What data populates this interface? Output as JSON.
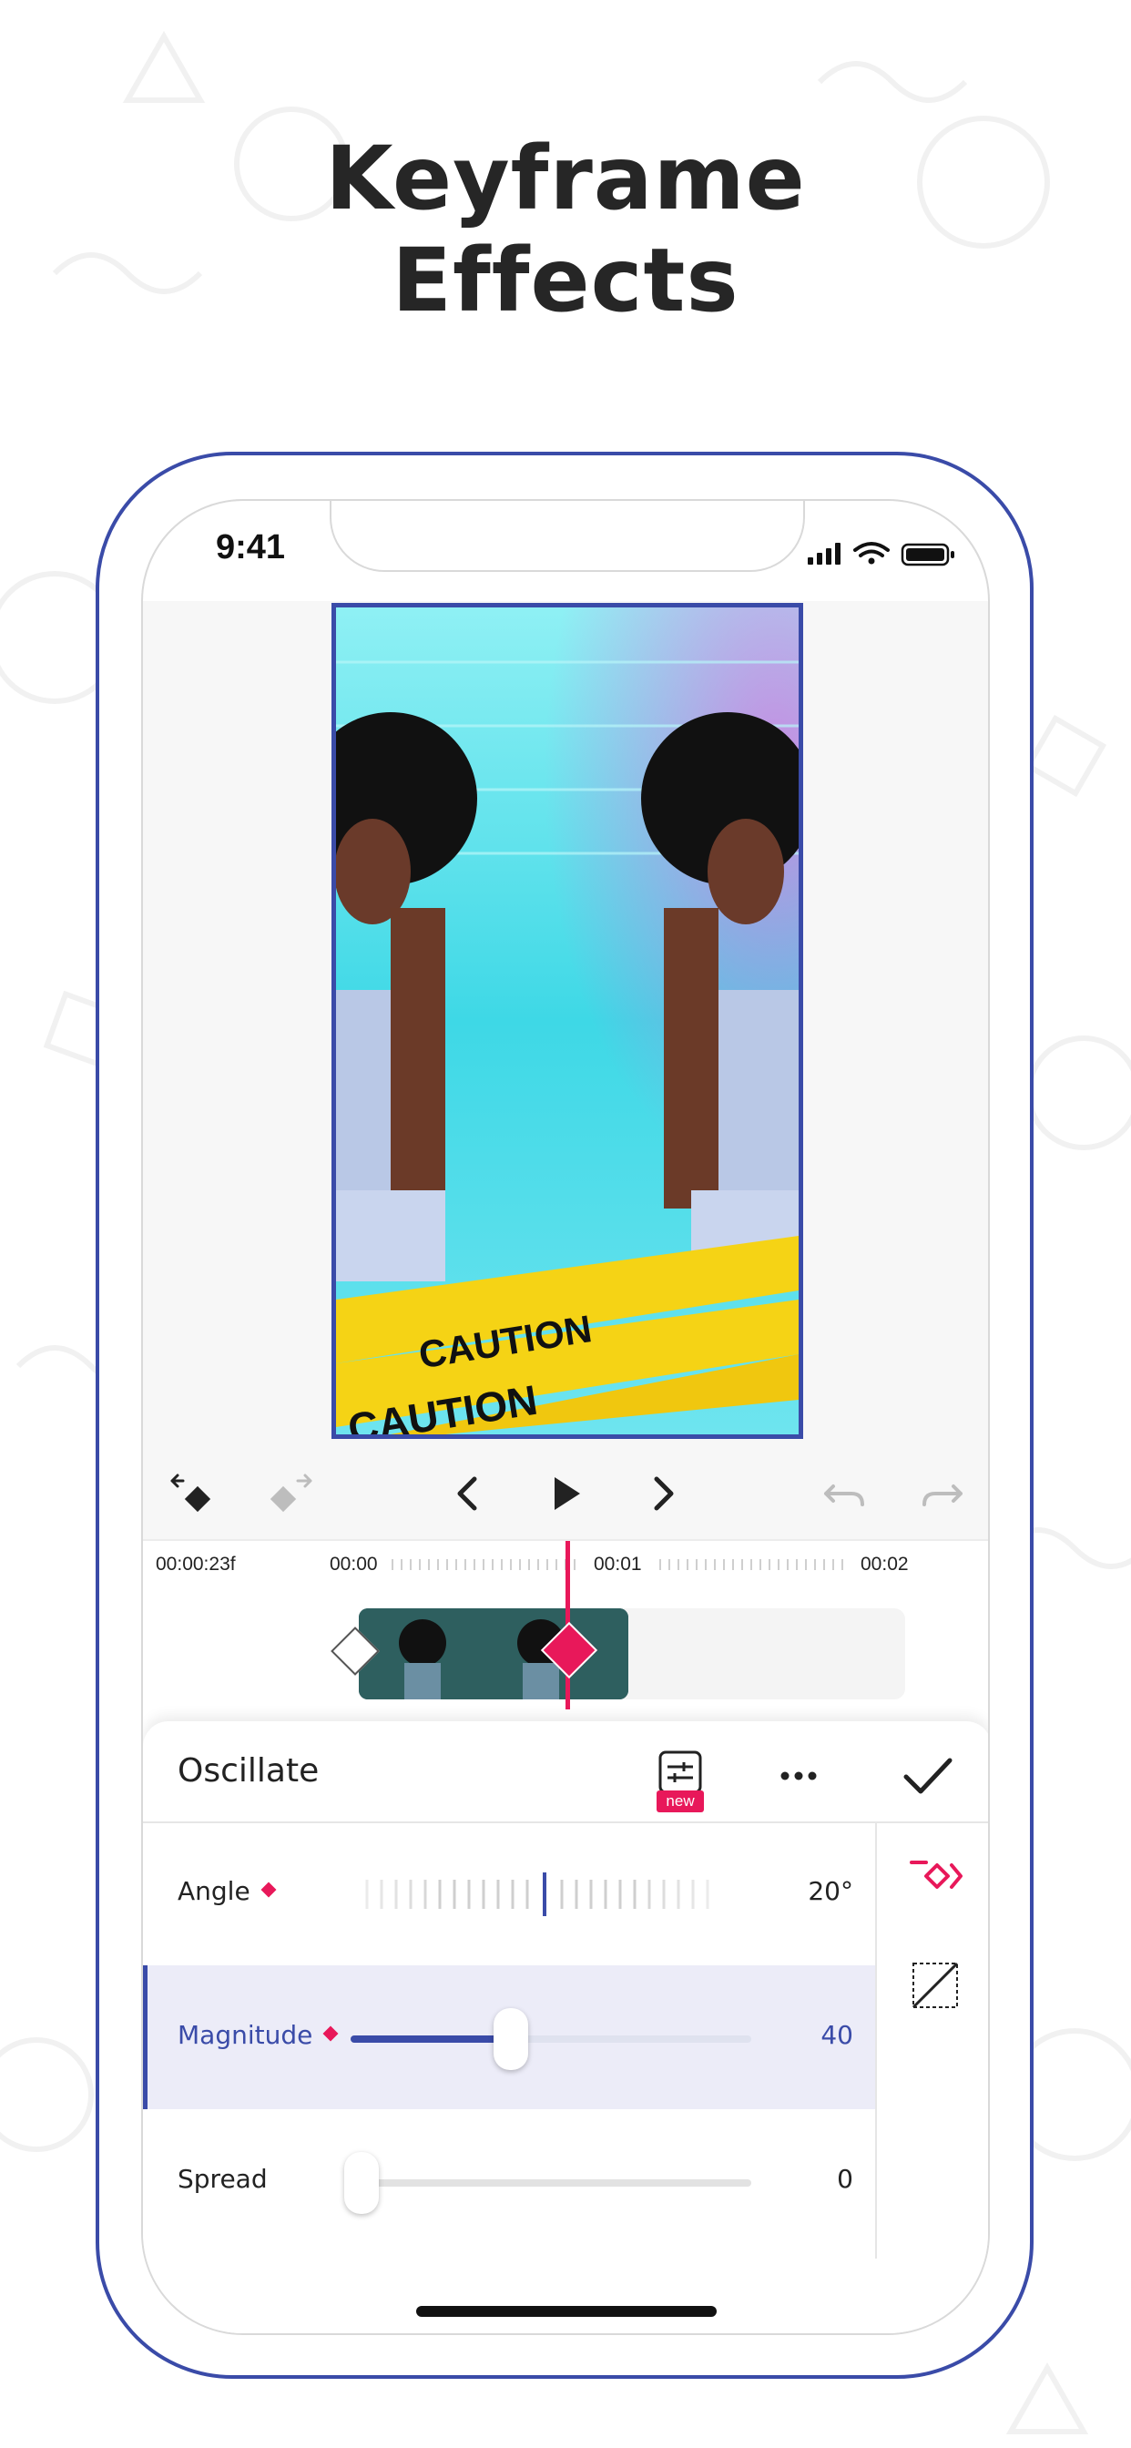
{
  "headline": {
    "line1": "Keyframe",
    "line2": "Effects"
  },
  "status_bar": {
    "time": "9:41"
  },
  "colors": {
    "accent": "#3a4ba8",
    "keyframe": "#e8185a",
    "clip": "#2e5f5f"
  },
  "toolbar": {
    "buttons": [
      "prev-keyframe-icon",
      "next-keyframe-icon",
      "chevron-left-icon",
      "play-icon",
      "chevron-right-icon",
      "undo-icon",
      "redo-icon"
    ]
  },
  "timeline": {
    "current_time": "00:00:23f",
    "ticks": [
      "00:00",
      "00:01",
      "00:02"
    ]
  },
  "panel": {
    "title": "Oscillate",
    "new_badge": "new",
    "params": [
      {
        "label": "Angle",
        "value": "20°",
        "control": "dial"
      },
      {
        "label": "Magnitude",
        "value": "40",
        "level": 0.4,
        "selected": true
      },
      {
        "label": "Spread",
        "value": "0",
        "level": 0.0
      }
    ]
  },
  "preview": {
    "caption": "CAUTION"
  }
}
